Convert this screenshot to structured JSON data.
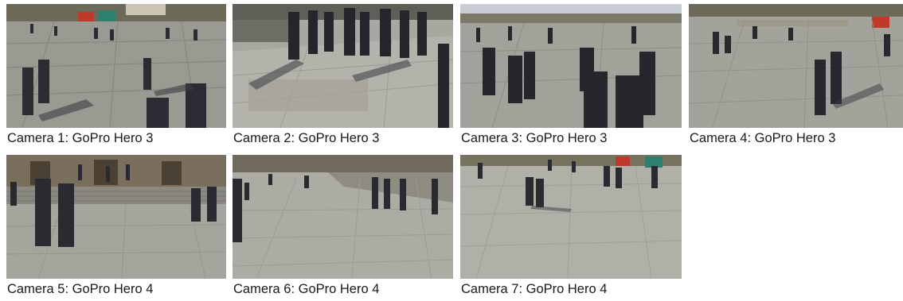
{
  "cameras": [
    {
      "caption": "Camera 1: GoPro Hero 3"
    },
    {
      "caption": "Camera 2: GoPro Hero 3"
    },
    {
      "caption": "Camera 3: GoPro Hero 3"
    },
    {
      "caption": "Camera 4: GoPro Hero 3"
    },
    {
      "caption": "Camera 5: GoPro Hero 4"
    },
    {
      "caption": "Camera 6: GoPro Hero 4"
    },
    {
      "caption": "Camera 7: GoPro Hero 4"
    }
  ]
}
